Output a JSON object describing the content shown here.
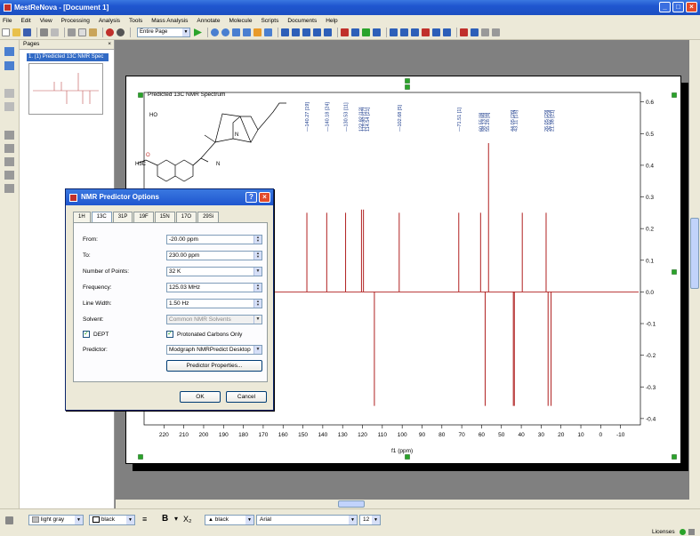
{
  "window": {
    "title": "MestReNova - [Document 1]"
  },
  "menu": [
    "File",
    "Edit",
    "View",
    "Processing",
    "Analysis",
    "Tools",
    "Mass Analysis",
    "Annotate",
    "Molecule",
    "Scripts",
    "Documents",
    "Help"
  ],
  "toolbar": {
    "zoom_mode": "Entire Page"
  },
  "pages_panel": {
    "title": "Pages",
    "item": "1. (1) Predicted 13C NMR Spec"
  },
  "spectrum": {
    "title": "Predicted 13C NMR Spectrum",
    "xlabel": "f1 (ppm)",
    "peak_labels": [
      "—140.27 [19]",
      "—140.18 [24]",
      "—130.53 [11]",
      "122.92 [12]",
      "119.80 [17]",
      "114.54 [21]",
      "—102.68 [5]",
      "—71.51 [1]",
      "60.55 [9]",
      "58.13 [6]",
      "55.28 [8]",
      "44.05 [26]",
      "43.11 [18]",
      "26.05 [29]",
      "26.02 [23]",
      "21.38 [21]"
    ]
  },
  "chart_data": {
    "type": "bar",
    "title": "Predicted 13C NMR Spectrum",
    "xlabel": "f1 (ppm)",
    "ylabel": "",
    "xlim": [
      230,
      -20
    ],
    "ylim": [
      -0.42,
      0.63
    ],
    "x_ticks": [
      220,
      210,
      200,
      190,
      180,
      170,
      160,
      150,
      140,
      130,
      120,
      110,
      100,
      90,
      80,
      70,
      60,
      50,
      40,
      30,
      20,
      10,
      0,
      -10
    ],
    "y_ticks": [
      0.6,
      0.5,
      0.4,
      0.3,
      0.2,
      0.1,
      0.0,
      -0.1,
      -0.2,
      -0.3,
      -0.4
    ],
    "peaks": [
      {
        "x": 148,
        "y": 0.25
      },
      {
        "x": 138,
        "y": 0.25
      },
      {
        "x": 128.5,
        "y": 0.25
      },
      {
        "x": 120.5,
        "y": 0.26
      },
      {
        "x": 119.5,
        "y": 0.26
      },
      {
        "x": 114,
        "y": -0.36
      },
      {
        "x": 101.5,
        "y": 0.25
      },
      {
        "x": 71.5,
        "y": 0.25
      },
      {
        "x": 60.5,
        "y": 0.25
      },
      {
        "x": 58.2,
        "y": -0.36
      },
      {
        "x": 56.5,
        "y": 0.47
      },
      {
        "x": 44,
        "y": -0.36
      },
      {
        "x": 43.5,
        "y": -0.36
      },
      {
        "x": 39.5,
        "y": 0.25
      },
      {
        "x": 27.5,
        "y": 0.25
      },
      {
        "x": 26.5,
        "y": -0.36
      },
      {
        "x": 25,
        "y": -0.36
      }
    ]
  },
  "dialog": {
    "title": "NMR Predictor Options",
    "tabs": [
      "1H",
      "13C",
      "31P",
      "19F",
      "15N",
      "17O",
      "29Si"
    ],
    "active_tab": "13C",
    "fields": {
      "from_label": "From:",
      "from_value": "-20.00 ppm",
      "to_label": "To:",
      "to_value": "230.00 ppm",
      "points_label": "Number of Points:",
      "points_value": "32 K",
      "freq_label": "Frequency:",
      "freq_value": "125.03 MHz",
      "width_label": "Line Width:",
      "width_value": "1.50 Hz",
      "solvent_label": "Solvent:",
      "solvent_value": "Common NMR Solvents",
      "dept_label": "DEPT",
      "protonated_label": "Protonated Carbons Only",
      "predictor_label": "Predictor:",
      "predictor_value": "Modgraph NMRPredict Desktop",
      "props_button": "Predictor Properties..."
    },
    "ok": "OK",
    "cancel": "Cancel"
  },
  "bottom": {
    "fill_color": "light gray",
    "line_color": "black",
    "text_color": "black",
    "font": "Arial",
    "font_size": "12",
    "status": "Licenses"
  },
  "colors": {
    "spectrum": "#b02020",
    "molecule_atoms": "#c0302b",
    "title_bar": "#1f56cf"
  }
}
